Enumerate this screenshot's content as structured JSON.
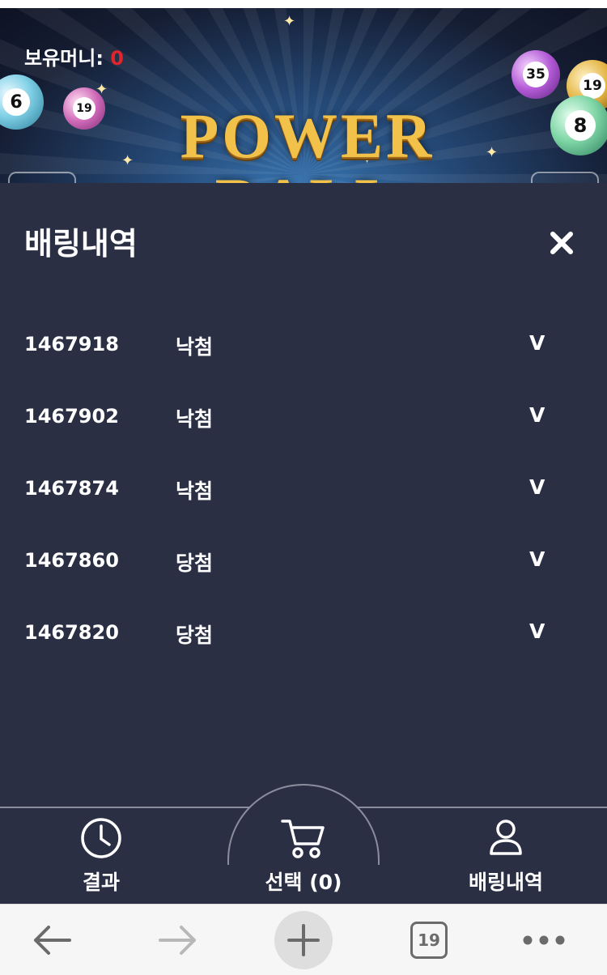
{
  "header": {
    "money_label": "보유머니:",
    "money_value": "0",
    "logo_text": "POWER BALL",
    "balls": [
      "6",
      "19",
      "35",
      "19",
      "8"
    ]
  },
  "panel": {
    "title": "배링내역",
    "close_icon": "close-icon",
    "bets": [
      {
        "id": "1467918",
        "status": "낙첨",
        "toggle": "V"
      },
      {
        "id": "1467902",
        "status": "낙첨",
        "toggle": "V"
      },
      {
        "id": "1467874",
        "status": "낙첨",
        "toggle": "V"
      },
      {
        "id": "1467860",
        "status": "당첨",
        "toggle": "V"
      },
      {
        "id": "1467820",
        "status": "당첨",
        "toggle": "V"
      }
    ]
  },
  "bottom_nav": {
    "results_label": "결과",
    "cart_label": "선택 (0)",
    "history_label": "배링내역"
  },
  "browser": {
    "tab_count": "19"
  },
  "colors": {
    "background": "#2b2f44",
    "money_value": "#e3242b",
    "logo_gold": "#f2c14a",
    "browser_bar": "#f6f6f6"
  }
}
